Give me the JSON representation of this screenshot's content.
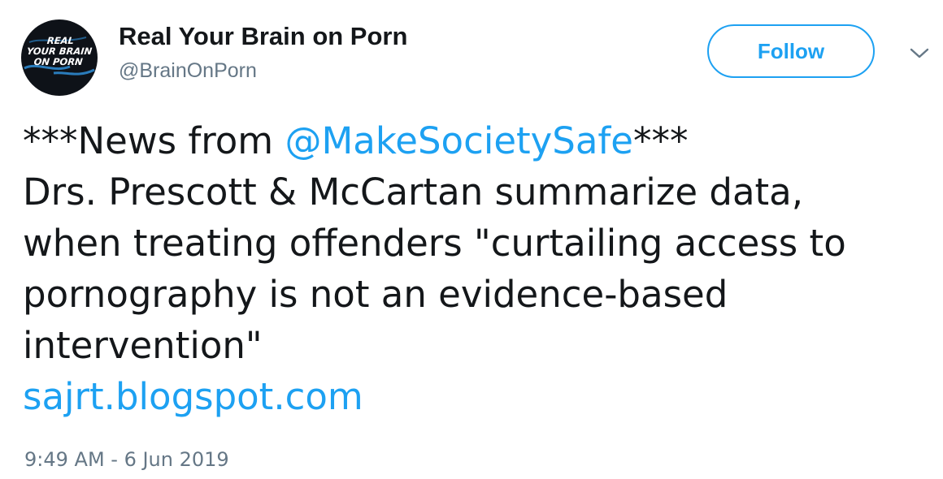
{
  "colors": {
    "accent": "#1da1f2",
    "text_primary": "#14171a",
    "text_secondary": "#657786",
    "avatar_bg": "#0e1218"
  },
  "author": {
    "display_name": "Real Your Brain on Porn",
    "handle": "@BrainOnPorn",
    "avatar_lines": [
      "REAL",
      "YOUR BRAIN",
      "ON PORN"
    ]
  },
  "actions": {
    "follow_label": "Follow",
    "more_icon": "chevron-down-icon"
  },
  "tweet": {
    "line1_prefix": "***News from ",
    "line1_mention": "@MakeSocietySafe",
    "line1_suffix": "***",
    "line2": "Drs. Prescott & McCartan summarize data,",
    "line3": "when treating offenders \"curtailing access to",
    "line4": "pornography is not an evidence-based",
    "line5": "intervention\"",
    "link": "sajrt.blogspot.com"
  },
  "timestamp": "9:49 AM - 6 Jun 2019"
}
